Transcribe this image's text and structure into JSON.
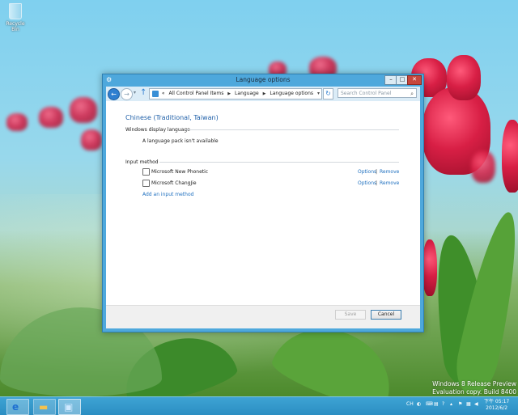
{
  "desktop": {
    "recycle_bin_label": "Recycle Bin"
  },
  "window": {
    "title": "Language options",
    "controls": {
      "minimize": "–",
      "maximize": "□",
      "close": "✕"
    },
    "address": {
      "chevron": "«",
      "breadcrumb": [
        "All Control Panel Items",
        "Language",
        "Language options"
      ]
    },
    "search": {
      "placeholder": "Search Control Panel"
    },
    "content": {
      "heading": "Chinese (Traditional, Taiwan)",
      "display_section_label": "Windows display language",
      "display_status": "A language pack isn't available",
      "input_section_label": "Input method",
      "input_methods": [
        {
          "name": "Microsoft New Phonetic",
          "options": "Options",
          "remove": "Remove"
        },
        {
          "name": "Microsoft ChangJie",
          "options": "Options",
          "remove": "Remove"
        }
      ],
      "add_input_method": "Add an input method",
      "separator": "|"
    },
    "buttons": {
      "save": "Save",
      "cancel": "Cancel"
    }
  },
  "watermark": {
    "line1": "Windows 8 Release Preview",
    "line2": "Evaluation copy. Build 8400"
  },
  "taskbar": {
    "tray": {
      "language": "CH"
    },
    "clock": {
      "time": "下午 05:17",
      "date": "2012/6/2"
    }
  }
}
